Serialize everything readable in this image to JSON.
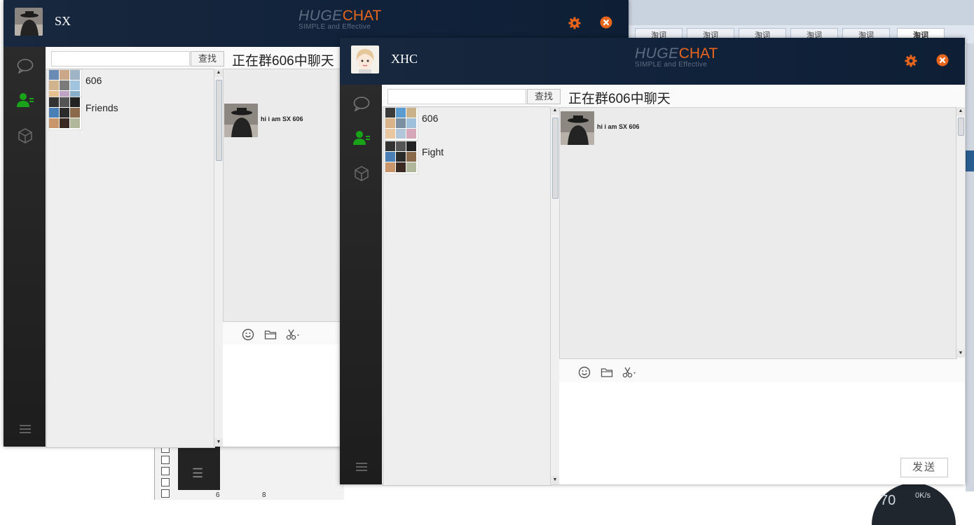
{
  "background": {
    "tabs": [
      "淘词",
      "淘词",
      "淘词",
      "淘词",
      "淘词",
      "淘词"
    ],
    "bottom_numbers": [
      "6",
      "8"
    ],
    "gauge_text": "70",
    "gauge_speed": "0K/s"
  },
  "app": {
    "logo_huge": "HUGE",
    "logo_chat": "CHAT",
    "slogan": "SIMPLE  and Effective"
  },
  "window_sx": {
    "username": "SX",
    "search_placeholder": "",
    "search_button": "查找",
    "chat_title": "正在群606中聊天",
    "groups": [
      {
        "label": "606"
      },
      {
        "label": "Friends"
      }
    ],
    "messages": [
      {
        "text": "hi i am SX 606"
      }
    ]
  },
  "window_xhc": {
    "username": "XHC",
    "search_placeholder": "",
    "search_button": "查找",
    "chat_title": "正在群606中聊天",
    "groups": [
      {
        "label": "606"
      },
      {
        "label": "Fight"
      }
    ],
    "messages": [
      {
        "text": "hi i am SX 606"
      }
    ],
    "send_button": "发送"
  },
  "colors": {
    "header_bg": "#12233a",
    "accent_orange": "#e8651c",
    "sidebar_bg": "#252525",
    "active_icon_green": "#19a319"
  }
}
